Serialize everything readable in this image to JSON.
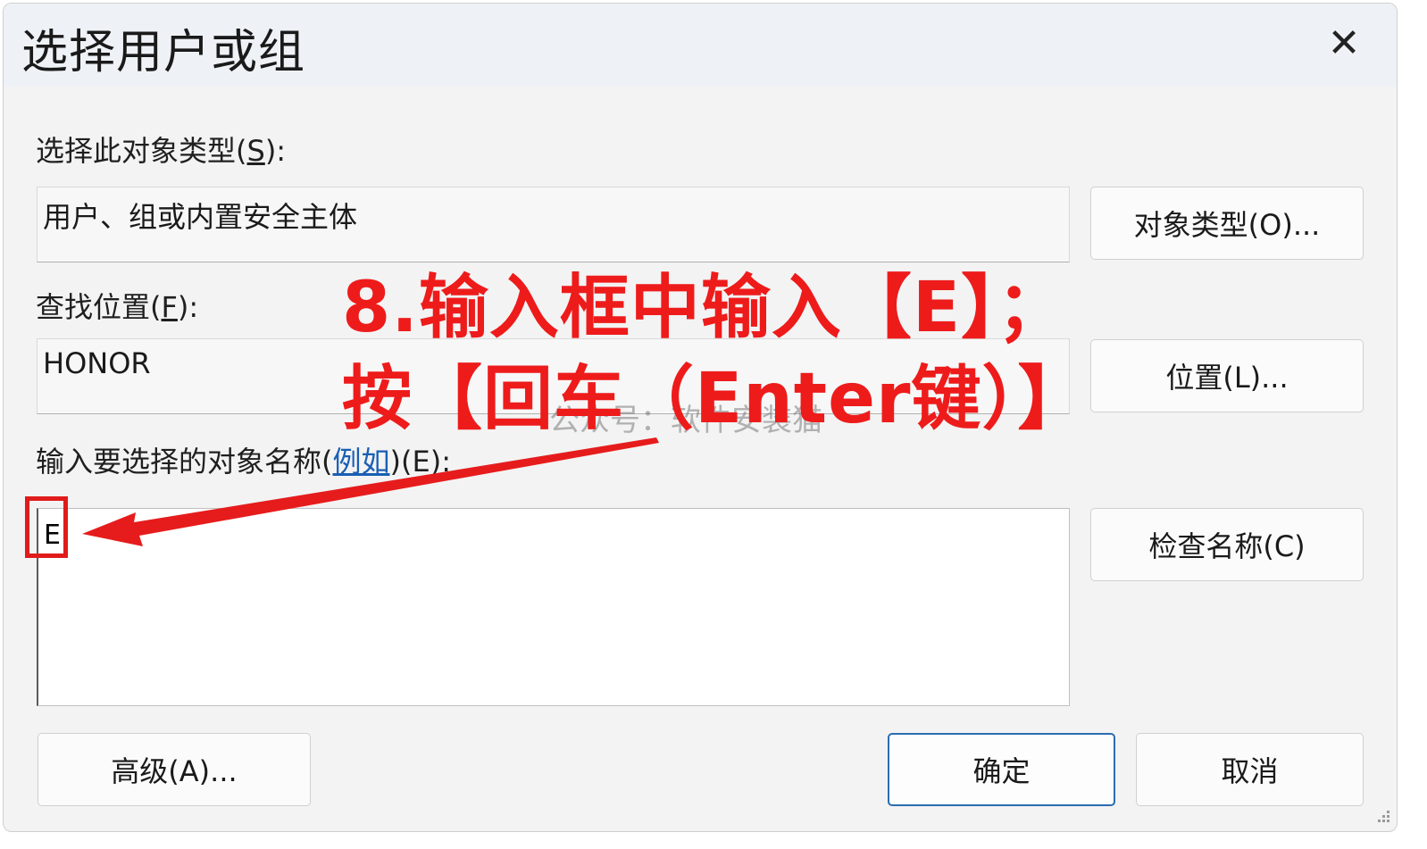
{
  "dialog": {
    "title": "选择用户或组",
    "close_glyph": "✕"
  },
  "object_type": {
    "label_pre": "选择此对象类型(",
    "label_key": "S",
    "label_post": "):",
    "value": "用户、组或内置安全主体",
    "button_label": "对象类型(O)..."
  },
  "location": {
    "label_pre": "查找位置(",
    "label_key": "F",
    "label_post": "):",
    "value": "HONOR",
    "button_label": "位置(L)..."
  },
  "names": {
    "label_pre": "输入要选择的对象名称(",
    "link_text": "例如",
    "label_post": ")(E):",
    "value": "E",
    "check_button_label": "检查名称(C)"
  },
  "footer": {
    "advanced_label": "高级(A)...",
    "ok_label": "确定",
    "cancel_label": "取消"
  },
  "annotation": {
    "line1": "8.输入框中输入【E】；",
    "line2": "按【回车（Enter键）】",
    "color": "#ee1b1b"
  },
  "watermark": {
    "text": "公众号：软件安装猫"
  }
}
